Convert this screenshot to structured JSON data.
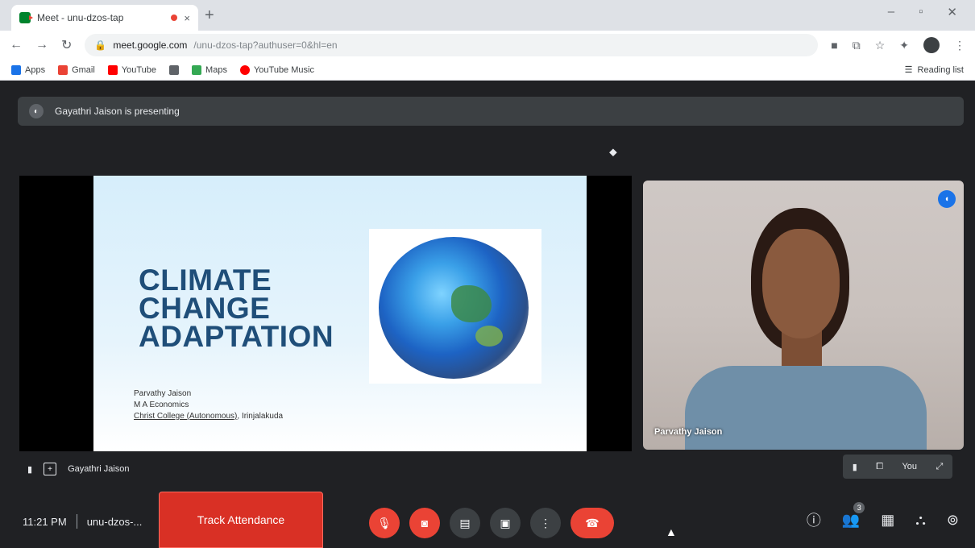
{
  "browser": {
    "tab_title": "Meet - unu-dzos-tap",
    "tab_close": "×",
    "new_tab": "+",
    "window_controls": [
      "–",
      "▫",
      "✕"
    ],
    "url_main": "meet.google.com",
    "url_rest": "/unu-dzos-tap?authuser=0&hl=en",
    "bookmarks": [
      {
        "label": "Apps",
        "color": "#1a73e8"
      },
      {
        "label": "Gmail",
        "color": "#ea4335"
      },
      {
        "label": "YouTube",
        "color": "#ff0000"
      },
      {
        "label": "",
        "color": "#5f6368"
      },
      {
        "label": "Maps",
        "color": "#34a853"
      },
      {
        "label": "YouTube Music",
        "color": "#ff0000"
      }
    ],
    "reading_list": "Reading list"
  },
  "meet": {
    "presenting_text": "Gayathri Jaison is presenting",
    "slide": {
      "title_lines": [
        "CLIMATE",
        "CHANGE",
        "ADAPTATION"
      ],
      "author": "Parvathy Jaison",
      "course": "M A Economics",
      "college": "Christ College (Autonomous)",
      "location": ", Irinjalakuda"
    },
    "presenter_label": "Gayathri Jaison",
    "self_tile_name": "Parvathy Jaison",
    "tile_tools_text": "You",
    "time": "11:21 PM",
    "meeting_code": "unu-dzos-...",
    "track_attendance": "Track Attendance",
    "participants_count": "3"
  },
  "colors": {
    "meet_bg": "#202124",
    "red": "#ea4335",
    "track_red": "#d93025",
    "slide_title": "#1f4e79"
  }
}
